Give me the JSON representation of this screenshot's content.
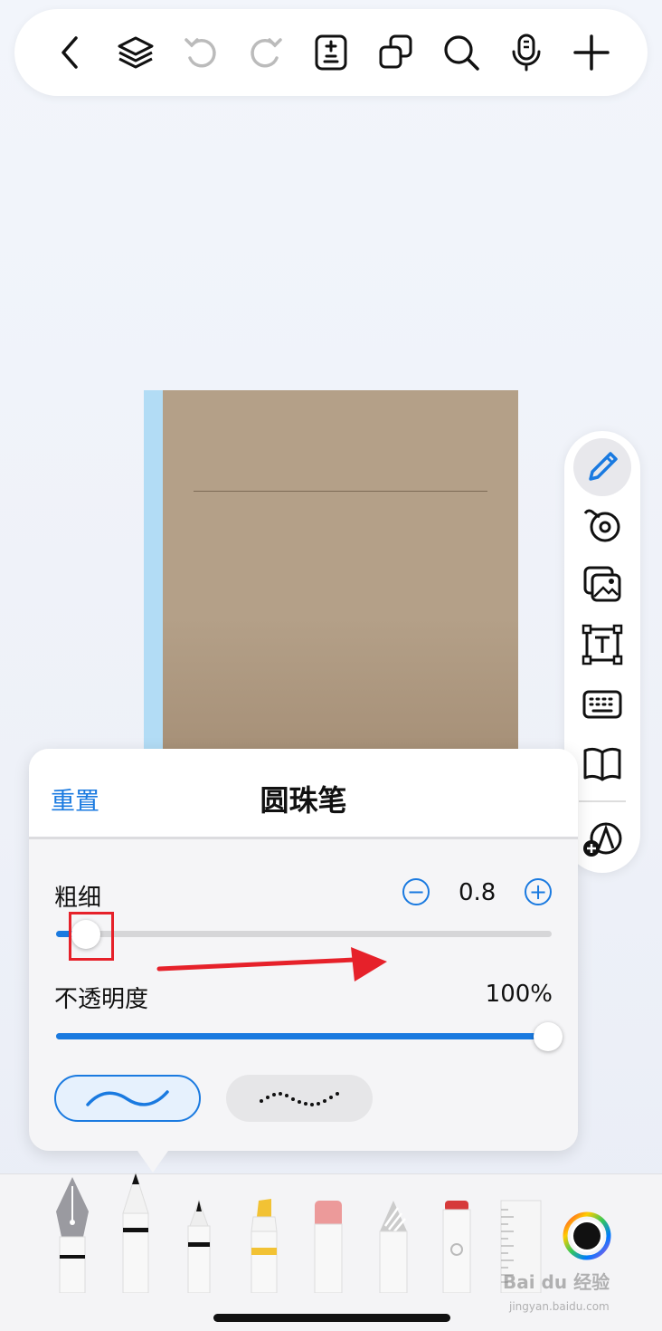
{
  "topbar": {
    "icons": [
      "back-icon",
      "layers-icon",
      "undo-icon",
      "redo-icon",
      "page-adjust-icon",
      "duplicate-icon",
      "search-icon",
      "microphone-icon",
      "add-icon"
    ]
  },
  "side_tools": [
    "pen-tool-icon",
    "tape-icon",
    "image-icon",
    "text-box-icon",
    "keyboard-icon",
    "book-icon",
    "shape-add-icon"
  ],
  "pen_panel": {
    "reset_label": "重置",
    "title": "圆珠笔",
    "thickness_label": "粗细",
    "thickness_value": "0.8",
    "thickness_fraction": 0.06,
    "opacity_label": "不透明度",
    "opacity_value": "100%",
    "opacity_fraction": 1.0
  },
  "colors": {
    "accent": "#1a7ae0",
    "highlight_box": "#e6212a",
    "notebook_cover": "#b4a088",
    "notebook_spine": "#b2dcf5"
  },
  "bottom_tools": [
    "fountain-pen",
    "ballpoint-pen",
    "fineliner",
    "highlighter",
    "eraser",
    "pencil",
    "marker",
    "ruler",
    "color-picker"
  ],
  "watermark": {
    "main": "Bai du 经验",
    "sub": "jingyan.baidu.com"
  }
}
